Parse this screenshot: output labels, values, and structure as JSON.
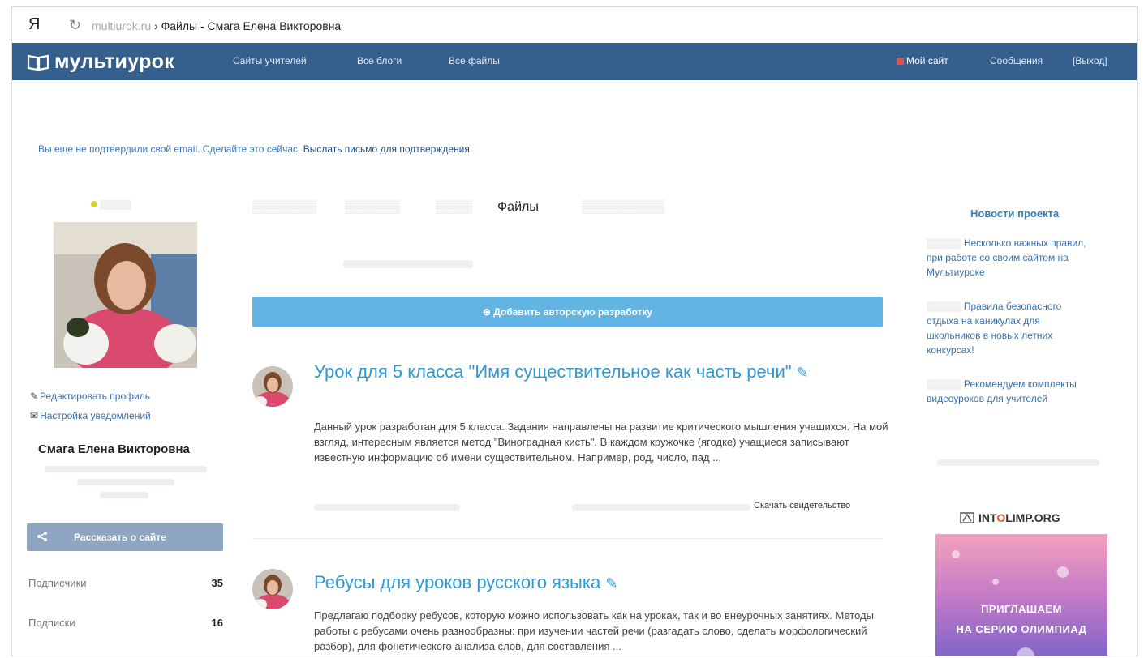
{
  "browser": {
    "ya": "Я",
    "reload": "↻",
    "host": "multiurok.ru",
    "title": " › Файлы - Смага Елена Викторовна"
  },
  "nav": {
    "logo": "мультиурок",
    "links": [
      "Сайты учителей",
      "Все блоги",
      "Все файлы"
    ],
    "my_site": "Мой сайт",
    "messages": "Сообщения",
    "logout": "[Выход]"
  },
  "notice": {
    "text": "Вы еще не подтвердили свой email. Сделайте это сейчас.",
    "link": "Выслать письмо для подтверждения"
  },
  "profile": {
    "edit": "Редактировать профиль",
    "notifications": "Настройка уведомлений",
    "name": "Смага Елена Викторовна",
    "share": "Рассказать о сайте",
    "stats": [
      {
        "label": "Подписчики",
        "value": "35"
      },
      {
        "label": "Подписки",
        "value": "16"
      }
    ]
  },
  "tabs": {
    "active": "Файлы"
  },
  "add_button": "Добавить авторскую разработку",
  "posts": [
    {
      "title": "Урок для 5 класса \"Имя существительное как часть речи\"",
      "edit_icon": "✎",
      "description": "Данный урок разработан для 5 класса. Задания направлены на развитие критического мышления учащихся. На мой взгляд, интересным является метод \"Виноградная кисть\". В каждом кружочке (ягодке) учащиеся записывают известную информацию об имени существительном. Например, род, число, пад ...",
      "certificate": "Скачать свидетельство"
    },
    {
      "title": "Ребусы для уроков русского языка",
      "edit_icon": "✎",
      "description": "Предлагаю подборку ребусов, которую можно использовать как на уроках, так и во внеурочных занятиях. Методы работы с ребусами очень разнообразны: при изучении частей речи (разгадать слово, сделать морфологический разбор), для фонетического анализа слов, для составления ..."
    }
  ],
  "news": {
    "title": "Новости проекта",
    "items": [
      {
        "text": "Несколько важных правил, при работе со своим сайтом на Мультиуроке"
      },
      {
        "text": "Правила безопасного отдыха на каникулах для школьников в новых летних конкурсах!"
      },
      {
        "text": "Рекомендуем комплекты видеоуроков для учителей"
      }
    ]
  },
  "ad": {
    "brand_pre": "INT",
    "brand_o": "O",
    "brand_post": "LIMP.ORG",
    "line1": "ПРИГЛАШАЕМ",
    "line2": "НА СЕРИЮ ОЛИМПИАД"
  },
  "icons": {
    "edit_profile": "✎",
    "notifications": "✉",
    "share": "share-icon"
  }
}
